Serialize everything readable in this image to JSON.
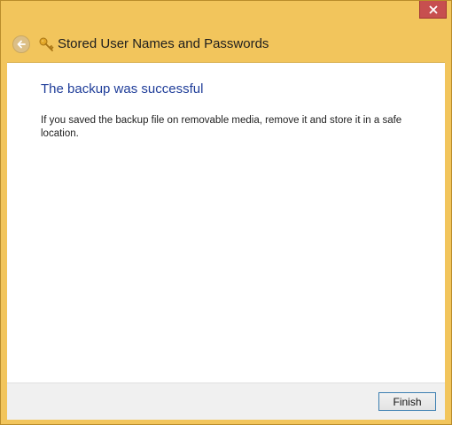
{
  "window": {
    "close_icon": "close-icon",
    "back_icon": "back-arrow-icon",
    "key_icon": "key-icon",
    "title": "Stored User Names and Passwords"
  },
  "content": {
    "heading": "The backup was successful",
    "message": "If you saved the backup file on removable media, remove it and store it in a safe location."
  },
  "footer": {
    "finish_label": "Finish"
  },
  "colors": {
    "frame": "#f2c55c",
    "heading": "#1f3d99",
    "close": "#c74f4f"
  }
}
